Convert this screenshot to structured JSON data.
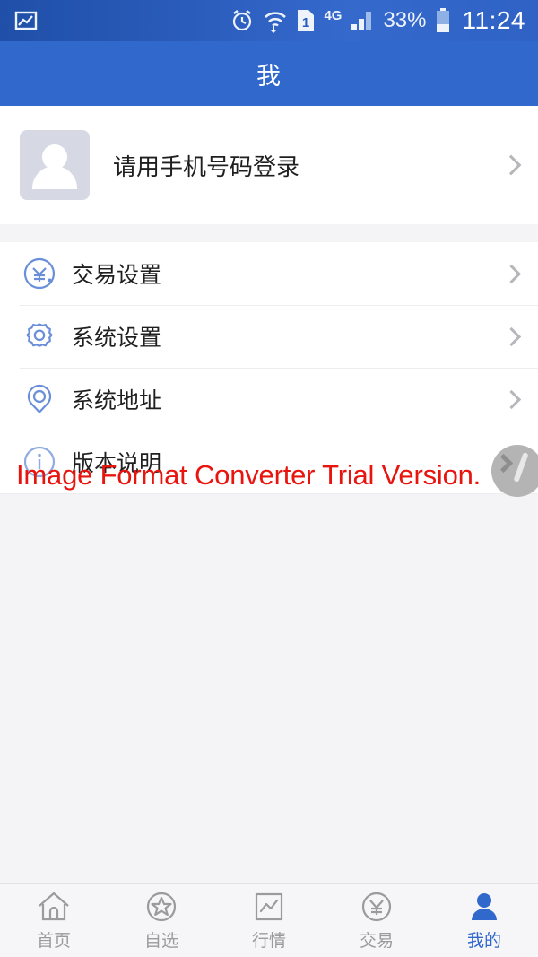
{
  "status_bar": {
    "left_icon": "image-icon",
    "alarm_icon": "alarm-clock-icon",
    "wifi_icon": "wifi-data-transfer-icon",
    "sim_label": "1",
    "network_label": "4G",
    "signal_icon": "signal-bars-icon",
    "battery_percent": "33%",
    "battery_icon": "battery-icon",
    "time": "11:24"
  },
  "header": {
    "title": "我"
  },
  "account": {
    "avatar_icon": "avatar-placeholder-icon",
    "login_label": "请用手机号码登录",
    "chevron_icon": "chevron-right-icon"
  },
  "menu": {
    "items": [
      {
        "icon": "yen-circle-icon",
        "label": "交易设置"
      },
      {
        "icon": "gear-icon",
        "label": "系统设置"
      },
      {
        "icon": "location-pin-icon",
        "label": "系统地址"
      },
      {
        "icon": "info-circle-icon",
        "label": "版本说明"
      }
    ]
  },
  "watermark": {
    "text": "Image Format Converter Trial Version.",
    "color": "#e8140e",
    "badge_icon": "edit-pencil-badge-icon"
  },
  "tabbar": {
    "items": [
      {
        "icon": "home-icon",
        "label": "首页",
        "active": false
      },
      {
        "icon": "star-icon",
        "label": "自选",
        "active": false
      },
      {
        "icon": "chart-icon",
        "label": "行情",
        "active": false
      },
      {
        "icon": "yen-icon",
        "label": "交易",
        "active": false
      },
      {
        "icon": "person-icon",
        "label": "我的",
        "active": true
      }
    ]
  },
  "colors": {
    "brand_blue": "#3068cc",
    "icon_blue": "#6a8fd8",
    "page_background": "#f4f4f6",
    "card_background": "#ffffff",
    "inactive_gray": "#9a9a9f"
  }
}
